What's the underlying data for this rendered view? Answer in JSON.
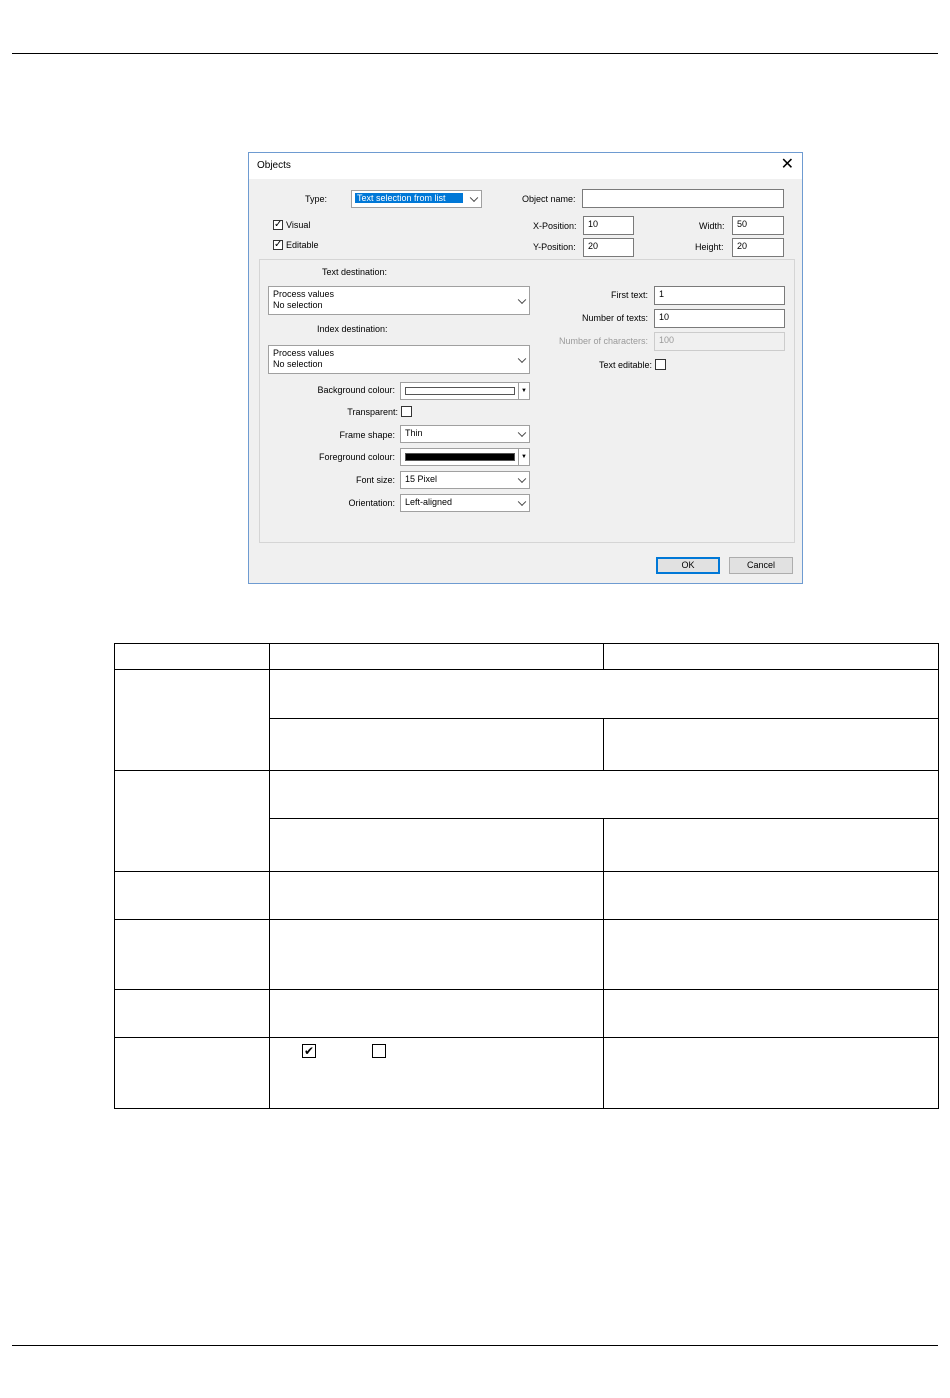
{
  "dialog": {
    "title": "Objects",
    "close_icon": "close-icon",
    "type_label": "Type:",
    "type_value": "Text selection from list",
    "object_name_label": "Object name:",
    "object_name_value": "",
    "visual_label": "Visual",
    "visual_checked": true,
    "editable_label": "Editable",
    "editable_checked": true,
    "x_position_label": "X-Position:",
    "x_position_value": "10",
    "y_position_label": "Y-Position:",
    "y_position_value": "20",
    "width_label": "Width:",
    "width_value": "50",
    "height_label": "Height:",
    "height_value": "20",
    "text_destination_label": "Text destination:",
    "text_destination_line1": "Process values",
    "text_destination_line2": "No selection",
    "index_destination_label": "Index destination:",
    "index_destination_line1": "Process values",
    "index_destination_line2": "No selection",
    "background_colour_label": "Background colour:",
    "background_colour": "#ffffff",
    "transparent_label": "Transparent:",
    "transparent_checked": false,
    "frame_shape_label": "Frame shape:",
    "frame_shape_value": "Thin",
    "foreground_colour_label": "Foreground colour:",
    "foreground_colour": "#000000",
    "font_size_label": "Font size:",
    "font_size_value": "15 Pixel",
    "orientation_label": "Orientation:",
    "orientation_value": "Left-aligned",
    "first_text_label": "First text:",
    "first_text_value": "1",
    "number_of_texts_label": "Number of texts:",
    "number_of_texts_value": "10",
    "number_of_characters_label": "Number of characters:",
    "number_of_characters_value": "100",
    "text_editable_label": "Text editable:",
    "text_editable_checked": false,
    "ok_label": "OK",
    "cancel_label": "Cancel"
  },
  "table": {
    "checkbox_checked_icon": "checkbox-checked-icon",
    "checkbox_unchecked_icon": "checkbox-unchecked-icon"
  },
  "colors": {
    "selection_highlight": "#0078d7",
    "dialog_border": "#6e9bd1",
    "dialog_background": "#f0f0f0"
  }
}
